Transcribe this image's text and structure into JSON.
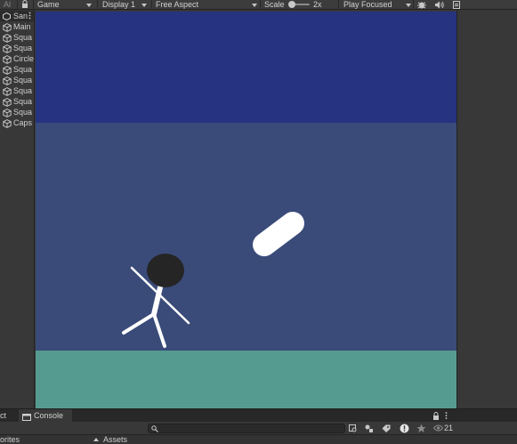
{
  "toolbar": {
    "left_label": "Al",
    "game_tab": "Game",
    "display": "Display 1",
    "aspect": "Free Aspect",
    "scale_label": "Scale",
    "scale_value": "2x",
    "play_mode": "Play Focused"
  },
  "hierarchy": {
    "scene": "San",
    "items": [
      {
        "label": "Main"
      },
      {
        "label": "Squa"
      },
      {
        "label": "Squa"
      },
      {
        "label": "Circle"
      },
      {
        "label": "Squa"
      },
      {
        "label": "Squa"
      },
      {
        "label": "Squa"
      },
      {
        "label": "Squa"
      },
      {
        "label": "Squa"
      },
      {
        "label": "Caps"
      }
    ]
  },
  "bottom_panel": {
    "tabs": [
      {
        "label": "ct"
      },
      {
        "label": "Console"
      }
    ],
    "hidden_count": "21",
    "favorites_label": "orites",
    "assets_label": "Assets"
  },
  "colors": {
    "sky_top": "#253380",
    "sky_mid": "#3a4b79",
    "ground": "#559b90",
    "head": "#252525",
    "body": "#ffffff"
  },
  "icons": {
    "bug": "bug-icon",
    "mute": "audio-icon",
    "menu": "kebab-menu-icon"
  }
}
